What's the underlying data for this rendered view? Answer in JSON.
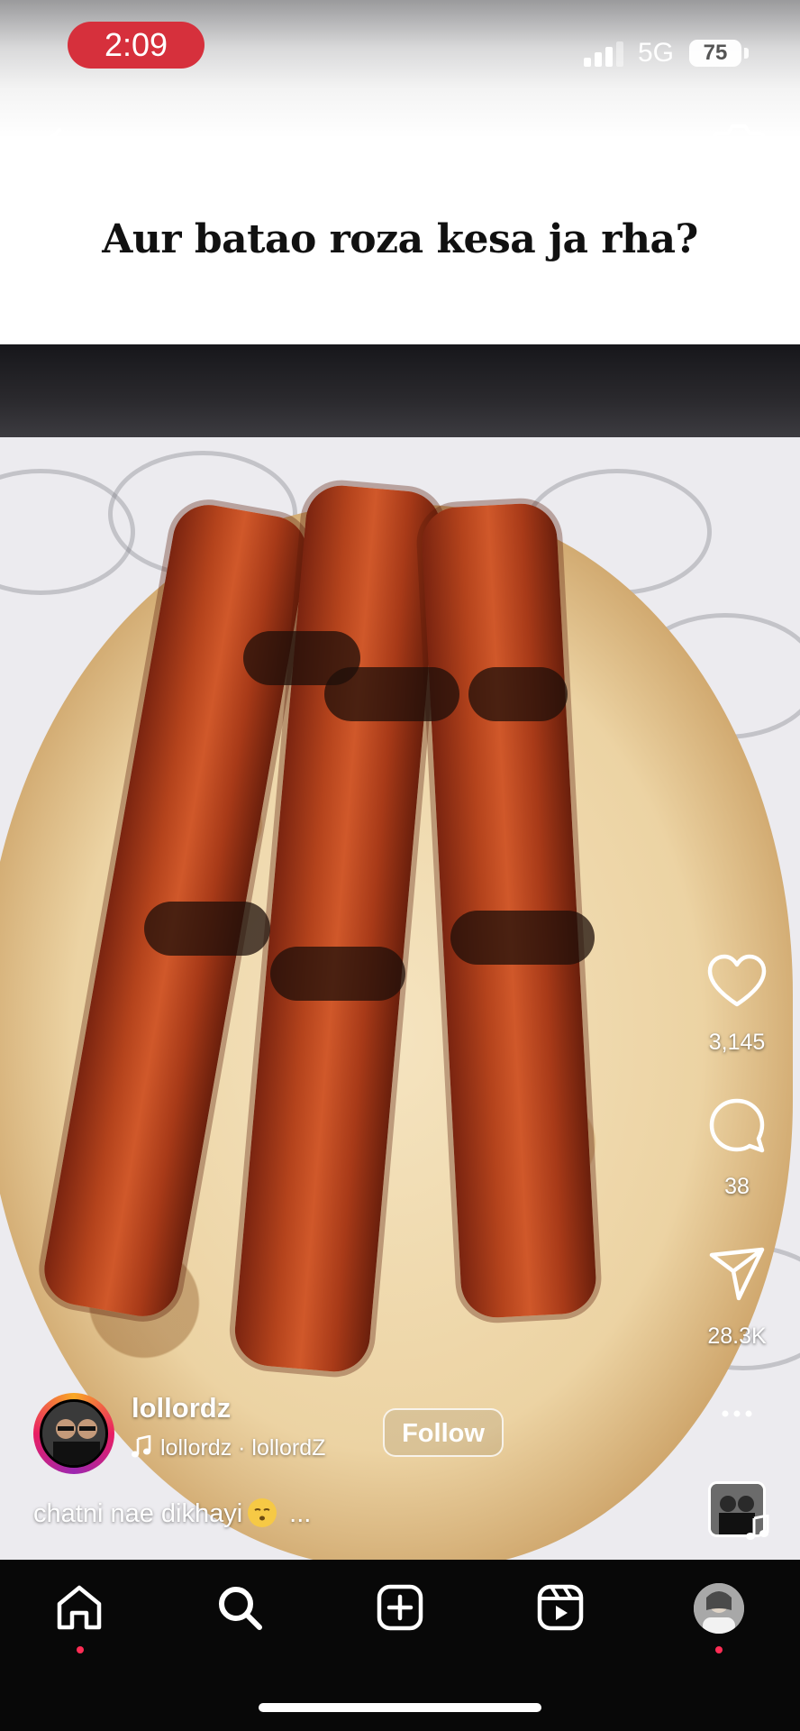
{
  "status_bar": {
    "time": "2:09",
    "network": "5G",
    "battery": "75"
  },
  "overlay_text": "Aur batao roza kesa ja rha?",
  "actions": {
    "likes": "3,145",
    "comments": "38",
    "shares": "28.3K"
  },
  "author": {
    "username": "lollordz",
    "audio": "lollordz · lollordZ",
    "follow_label": "Follow"
  },
  "caption": {
    "text": "chatni nae dikhayi",
    "more": "..."
  },
  "nav": {
    "items": [
      "home",
      "search",
      "create",
      "reels",
      "profile"
    ]
  },
  "icons": {
    "back": "chevron-left-icon",
    "camera": "camera-icon",
    "like": "heart-icon",
    "comment": "comment-icon",
    "share": "send-icon",
    "more": "more-icon"
  },
  "colors": {
    "notification_dot": "#ff2d55",
    "time_pill": "#d6303c",
    "nav_background": "#080808"
  }
}
